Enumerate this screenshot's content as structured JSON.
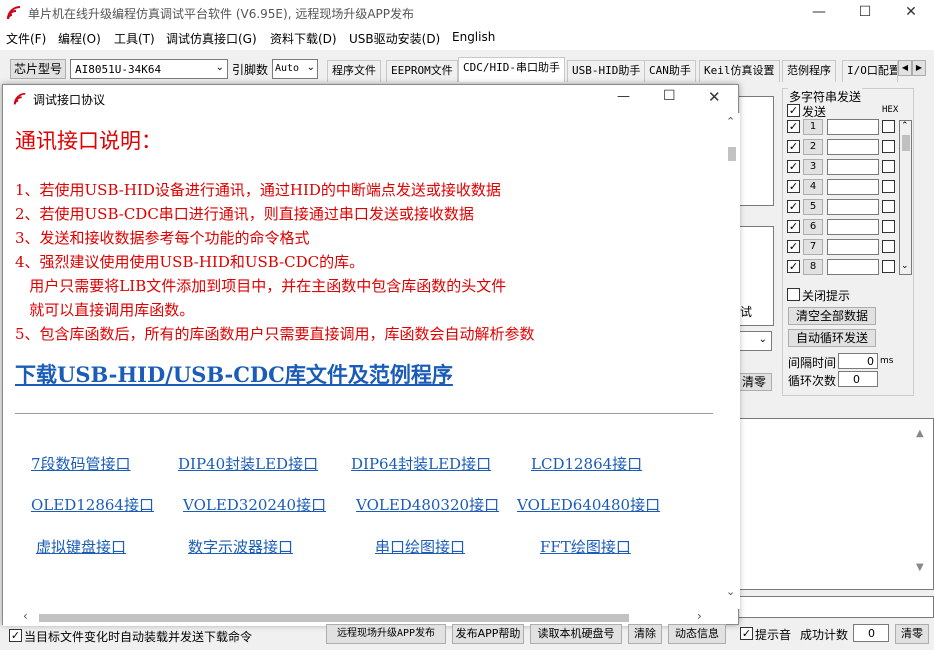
{
  "app": {
    "title": "单片机在线升级编程仿真调试平台软件 (V6.95E), 远程现场升级APP发布",
    "win_min": "—",
    "win_max": "☐",
    "win_close": "✕"
  },
  "menu": [
    "文件(F)",
    "编程(O)",
    "工具(T)",
    "调试仿真接口(G)",
    "资料下载(D)",
    "USB驱动安装(D)",
    "English"
  ],
  "toolbar": {
    "chip_label": "芯片型号",
    "chip_value": "AI8051U-34K64",
    "pins_label": "引脚数",
    "pins_value": "Auto"
  },
  "tabs": [
    "程序文件",
    "EEPROM文件",
    "CDC/HID-串口助手",
    "USB-HID助手",
    "CAN助手",
    "Keil仿真设置",
    "范例程序",
    "I/O口配置"
  ],
  "dialog": {
    "title": "调试接口协议",
    "heading": "通讯接口说明：",
    "lines": [
      "1、若使用USB-HID设备进行通讯，通过HID的中断端点发送或接收数据",
      "2、若使用USB-CDC串口进行通讯，则直接通过串口发送或接收数据",
      "3、发送和接收数据参考每个功能的命令格式",
      "4、强烈建议使用使用USB-HID和USB-CDC的库。",
      "   用户只需要将LIB文件添加到项目中，并在主函数中包含库函数的头文件",
      "   就可以直接调用库函数。",
      "5、包含库函数后，所有的库函数用户只需要直接调用，库函数会自动解析参数"
    ],
    "download_link": "下载USB-HID/USB-CDC库文件及范例程序",
    "links": [
      "7段数码管接口",
      "DIP40封装LED接口",
      "DIP64封装LED接口",
      "LCD12864接口",
      "OLED12864接口",
      "VOLED320240接口",
      "VOLED480320接口",
      "VOLED640480接口",
      "虚拟键盘接口",
      "数字示波器接口",
      "串口绘图接口",
      "FFT绘图接口"
    ]
  },
  "right_panel": {
    "group_title": "多字符串发送",
    "send_label": "发送",
    "hex_label": "HEX",
    "rows": [
      "1",
      "2",
      "3",
      "4",
      "5",
      "6",
      "7",
      "8"
    ],
    "close_tip": "关闭提示",
    "clear_all": "清空全部数据",
    "auto_loop": "自动循环发送",
    "interval_label": "间隔时间",
    "interval_value": "0",
    "interval_unit": "ms",
    "loop_label": "循环次数",
    "loop_value": "0"
  },
  "behind": {
    "partial_text": "试",
    "clear_btn": "清零"
  },
  "status": {
    "auto_load": "当目标文件变化时自动装载并发送下载命令",
    "btn_remote": "远程现场升级APP发布",
    "btn_help": "发布APP帮助",
    "btn_read": "读取本机硬盘号",
    "btn_clear": "清除",
    "btn_info": "动态信息",
    "tip_sound": "提示音",
    "success_label": "成功计数",
    "success_value": "0",
    "btn_zero": "清零"
  }
}
